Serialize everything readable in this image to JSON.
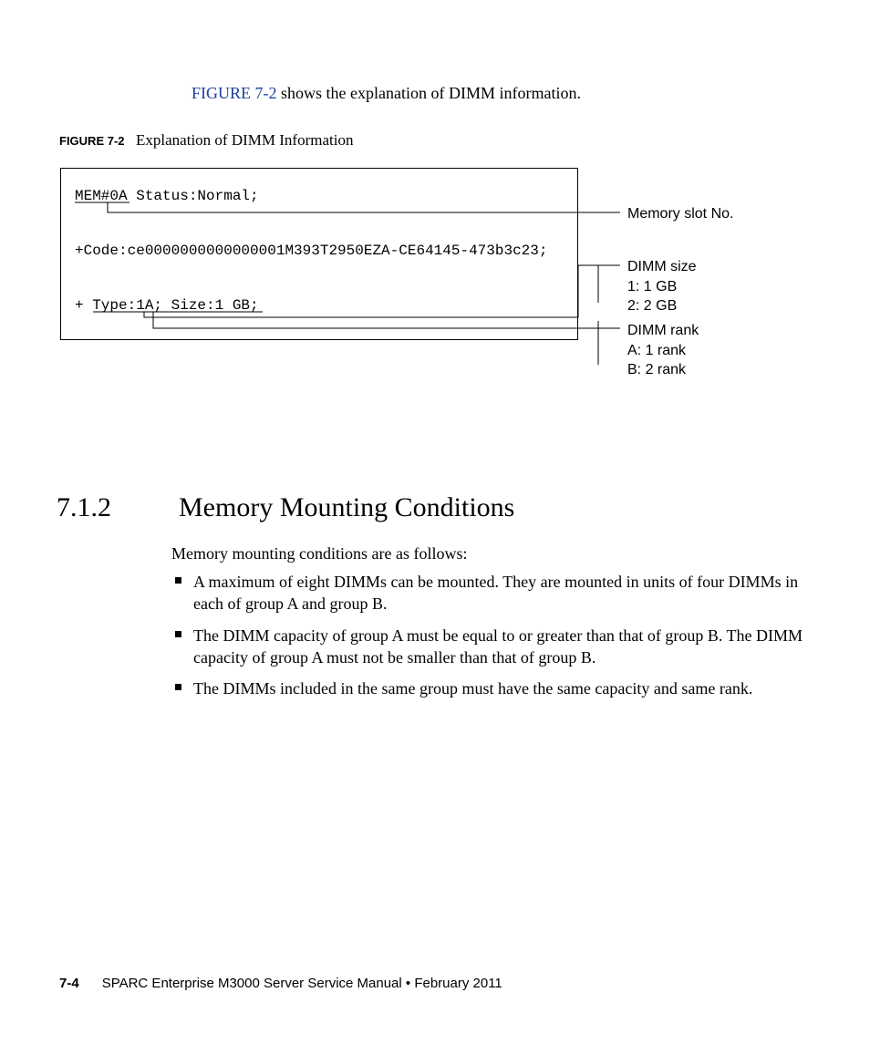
{
  "intro": {
    "link_text": "FIGURE 7-2",
    "rest": " shows the explanation of DIMM information."
  },
  "figure_caption": {
    "label": "FIGURE 7-2",
    "text": "Explanation of DIMM Information"
  },
  "code": {
    "line1": "MEM#0A Status:Normal;",
    "line2": "+Code:ce0000000000000001M393T2950EZA-CE64145-473b3c23;",
    "line3": "+ Type:1A; Size:1 GB;"
  },
  "callouts": {
    "memory_slot": "Memory slot No.",
    "dimm_size": "DIMM size\n1: 1 GB\n2: 2 GB",
    "dimm_rank": "DIMM rank\nA: 1 rank\nB: 2 rank"
  },
  "section": {
    "number": "7.1.2",
    "title": "Memory Mounting Conditions",
    "intro": "Memory mounting conditions are as follows:",
    "bullets": [
      "A maximum of eight DIMMs can be mounted. They are mounted in units of four DIMMs in each of group A and group B.",
      "The DIMM capacity of group A must be equal to or greater than that of group B. The DIMM capacity of group A must not be smaller than that of group B.",
      "The DIMMs included in the same group must have the same capacity and same rank."
    ]
  },
  "footer": {
    "page_num": "7-4",
    "title": "SPARC Enterprise M3000 Server Service Manual  •  February 2011"
  }
}
